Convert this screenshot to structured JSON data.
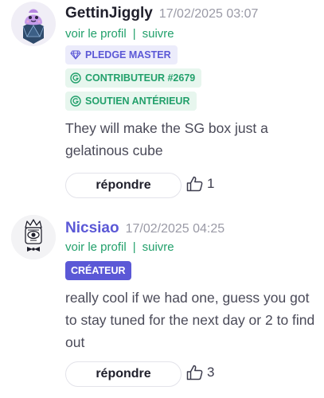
{
  "comments": [
    {
      "username": "GettinJiggly",
      "timestamp": "17/02/2025 03:07",
      "links": {
        "profile": "voir le profil",
        "separator": "|",
        "follow": "suivre"
      },
      "badges": [
        "PLEDGE MASTER",
        "CONTRIBUTEUR #2679",
        "SOUTIEN ANTÉRIEUR"
      ],
      "text": "They will make the SG box just a gelatinous cube",
      "reply_label": "répondre",
      "likes": "1",
      "avatar": "purple-slime-on-d20-dice-avatar"
    },
    {
      "username": "Nicsiao",
      "timestamp": "17/02/2025 04:25",
      "links": {
        "profile": "voir le profil",
        "separator": "|",
        "follow": "suivre"
      },
      "badges": [
        "CRÉATEUR"
      ],
      "text": "really cool if we had one, guess you got to stay tuned for the next day or 2 to find out",
      "reply_label": "répondre",
      "likes": "3",
      "avatar": "crowned-eye-with-bowtie-avatar"
    }
  ],
  "colors": {
    "accent": "#5b58d6",
    "green": "#22a06b"
  }
}
